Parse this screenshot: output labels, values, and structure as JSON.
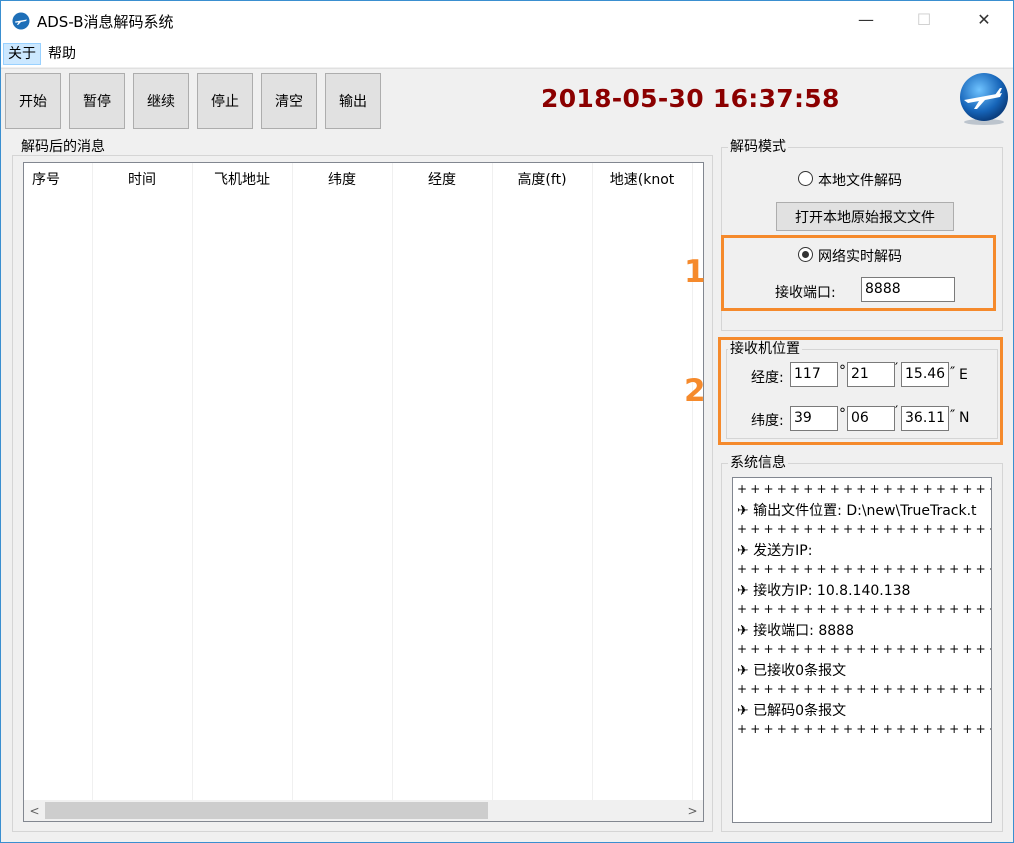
{
  "window": {
    "title": "ADS-B消息解码系统",
    "minimize": "—",
    "maximize": "☐",
    "close": "✕"
  },
  "menu": {
    "about": "关于",
    "help": "帮助"
  },
  "toolbar": {
    "start": "开始",
    "pause": "暂停",
    "resume": "继续",
    "stop": "停止",
    "clear": "清空",
    "export": "输出",
    "clock": "2018-05-30 16:37:58"
  },
  "messages": {
    "group_label": "解码后的消息",
    "columns": [
      "序号",
      "时间",
      "飞机地址",
      "纬度",
      "经度",
      "高度(ft)",
      "地速(knot"
    ],
    "scroll_left": "<",
    "scroll_right": ">"
  },
  "decode_mode": {
    "group_label": "解码模式",
    "local_option": "本地文件解码",
    "open_file_button": "打开本地原始报文文件",
    "network_option": "网络实时解码",
    "port_label": "接收端口:",
    "port_value": "8888",
    "annotation_1": "1"
  },
  "receiver": {
    "group_label": "接收机位置",
    "lon_label": "经度:",
    "lon_deg": "117",
    "lon_min": "21",
    "lon_sec": "15.46",
    "lon_dir": "E",
    "lat_label": "纬度:",
    "lat_deg": "39",
    "lat_min": "06",
    "lat_sec": "36.11",
    "lat_dir": "N",
    "deg_symbol": "°",
    "min_symbol": "′",
    "sec_symbol": "″",
    "annotation_2": "2"
  },
  "system_info": {
    "group_label": "系统信息",
    "separator": "++++++++++++++++++++++",
    "lines": [
      "✈ 输出文件位置: D:\\new\\TrueTrack.t",
      "✈ 发送方IP:",
      "✈ 接收方IP: 10.8.140.138",
      "✈ 接收端口: 8888",
      "✈ 已接收0条报文",
      "✈ 已解码0条报文"
    ]
  },
  "colors": {
    "clock": "#8b0000",
    "annotation": "#f58a2c",
    "window_border": "#3a8fd0"
  }
}
